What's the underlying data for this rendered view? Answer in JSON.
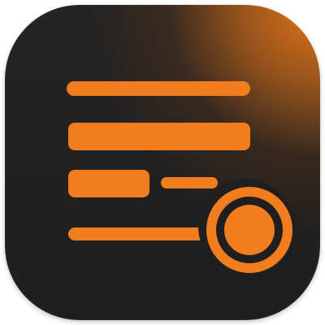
{
  "app": {
    "name": ""
  },
  "icon": {
    "semantic": "list-icon",
    "accent_color": "#f27d1f",
    "background_color": "#1f1f1f",
    "glow_color": "#f27a16"
  }
}
